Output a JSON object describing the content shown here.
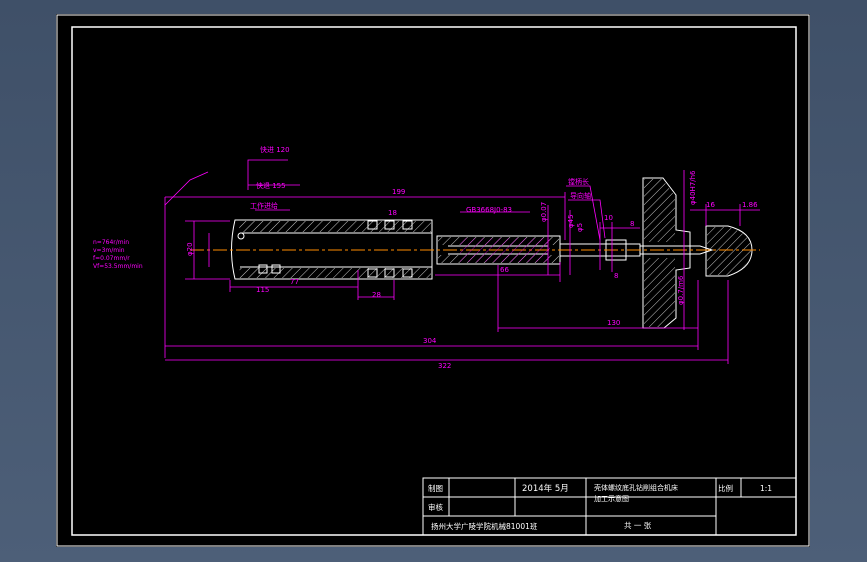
{
  "colors": {
    "background": "#000000",
    "frame": "#ffffff",
    "dimension": "#ff00ff",
    "part": "#ffffff",
    "centerline": "#ff8c00"
  },
  "drawing": {
    "annotations": {
      "fast_forward": "快进 120",
      "fast_back": "快退 155",
      "work_feed": "工作进给",
      "tool_label_1": "镗柄长",
      "tool_label_2": "导向轴",
      "standard": "GB3668J0-83",
      "cutting_params": [
        "n=764r/min",
        "v=3m/min",
        "f=0.07mm/r",
        "Vf=53.5mm/min"
      ]
    },
    "dimensions": {
      "d199": "199",
      "d304": "304",
      "d322": "322",
      "d130": "130",
      "d77": "77",
      "d115": "115",
      "d28": "28",
      "d66": "66",
      "d8": "8",
      "d16": "16",
      "d1_86": "1.86",
      "d18": "18",
      "dia20": "φ20",
      "dia5": "φ5",
      "dia45": "φ45",
      "dia07": "φ0.07",
      "dia40": "φ40H7/h6",
      "dia_b": "φ0.7/m6",
      "d10": "10",
      "d8b": "8"
    }
  },
  "title_block": {
    "drawn_label": "制图",
    "review_label": "审核",
    "date": "2014年  5月",
    "title_line1": "壳体螺纹底孔钻削组合机床",
    "title_line2": "加工示意图",
    "scale_label": "比例",
    "scale_value": "1:1",
    "school": "扬州大学广陵学院机械81001班",
    "sheet": "共  一  张"
  }
}
